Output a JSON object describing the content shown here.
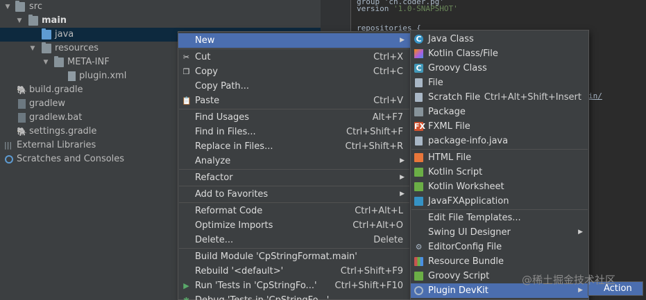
{
  "tree": {
    "items": [
      {
        "label": "src",
        "icon": "folder-icon",
        "arrow": "▼"
      },
      {
        "label": "main",
        "icon": "folder-icon",
        "arrow": "▼"
      },
      {
        "label": "java",
        "icon": "source-folder-icon",
        "arrow": ""
      },
      {
        "label": "resources",
        "icon": "resources-folder-icon",
        "arrow": "▼"
      },
      {
        "label": "META-INF",
        "icon": "folder-icon",
        "arrow": "▼"
      },
      {
        "label": "plugin.xml",
        "icon": "plugin-xml-icon",
        "arrow": ""
      },
      {
        "label": "build.gradle",
        "icon": "gradle-icon",
        "arrow": ""
      },
      {
        "label": "gradlew",
        "icon": "file-icon",
        "arrow": ""
      },
      {
        "label": "gradlew.bat",
        "icon": "file-icon",
        "arrow": ""
      },
      {
        "label": "settings.gradle",
        "icon": "gradle-icon",
        "arrow": ""
      },
      {
        "label": "External Libraries",
        "icon": "libraries-icon",
        "arrow": ""
      },
      {
        "label": "Scratches and Consoles",
        "icon": "scratches-icon",
        "arrow": ""
      }
    ]
  },
  "editor": {
    "line1": "group 'cn.coder.pg'",
    "line2_key": "version",
    "line2_val": "'1.0-SNAPSHOT'",
    "line3": "repositories {",
    "path_fragment": "in/"
  },
  "context_menu": {
    "items": [
      {
        "label": "New",
        "shortcut": "",
        "submenu": true
      },
      {
        "label": "Cut",
        "shortcut": "Ctrl+X",
        "icon": "cut-icon"
      },
      {
        "label": "Copy",
        "shortcut": "Ctrl+C",
        "icon": "copy-icon"
      },
      {
        "label": "Copy Path...",
        "shortcut": ""
      },
      {
        "label": "Paste",
        "shortcut": "Ctrl+V",
        "icon": "paste-icon"
      },
      {
        "label": "Find Usages",
        "shortcut": "Alt+F7"
      },
      {
        "label": "Find in Files...",
        "shortcut": "Ctrl+Shift+F"
      },
      {
        "label": "Replace in Files...",
        "shortcut": "Ctrl+Shift+R"
      },
      {
        "label": "Analyze",
        "shortcut": "",
        "submenu": true
      },
      {
        "label": "Refactor",
        "shortcut": "",
        "submenu": true
      },
      {
        "label": "Add to Favorites",
        "shortcut": "",
        "submenu": true
      },
      {
        "label": "Reformat Code",
        "shortcut": "Ctrl+Alt+L"
      },
      {
        "label": "Optimize Imports",
        "shortcut": "Ctrl+Alt+O"
      },
      {
        "label": "Delete...",
        "shortcut": "Delete"
      },
      {
        "label": "Build Module 'CpStringFormat.main'",
        "shortcut": ""
      },
      {
        "label": "Rebuild '<default>'",
        "shortcut": "Ctrl+Shift+F9"
      },
      {
        "label": "Run 'Tests in 'CpStringFo...'",
        "shortcut": "Ctrl+Shift+F10",
        "icon": "run-icon"
      },
      {
        "label": "Debug 'Tests in 'CpStringFo...'",
        "shortcut": "",
        "icon": "debug-icon"
      }
    ]
  },
  "new_submenu": {
    "items": [
      {
        "label": "Java Class",
        "shortcut": ""
      },
      {
        "label": "Kotlin Class/File",
        "shortcut": ""
      },
      {
        "label": "Groovy Class",
        "shortcut": ""
      },
      {
        "label": "File",
        "shortcut": ""
      },
      {
        "label": "Scratch File",
        "shortcut": "Ctrl+Alt+Shift+Insert"
      },
      {
        "label": "Package",
        "shortcut": ""
      },
      {
        "label": "FXML File",
        "shortcut": ""
      },
      {
        "label": "package-info.java",
        "shortcut": ""
      },
      {
        "label": "HTML File",
        "shortcut": ""
      },
      {
        "label": "Kotlin Script",
        "shortcut": ""
      },
      {
        "label": "Kotlin Worksheet",
        "shortcut": ""
      },
      {
        "label": "JavaFXApplication",
        "shortcut": ""
      },
      {
        "label": "Edit File Templates...",
        "shortcut": ""
      },
      {
        "label": "Swing UI Designer",
        "shortcut": "",
        "submenu": true
      },
      {
        "label": "EditorConfig File",
        "shortcut": ""
      },
      {
        "label": "Resource Bundle",
        "shortcut": ""
      },
      {
        "label": "Groovy Script",
        "shortcut": ""
      },
      {
        "label": "Plugin DevKit",
        "shortcut": "",
        "submenu": true
      }
    ]
  },
  "devkit_submenu": {
    "first_item": "Action"
  },
  "watermark": "@稀土掘金技术社区",
  "colors": {
    "highlight": "#4b6eaf",
    "background": "#3c3f41",
    "editor_bg": "#2b2b2b",
    "selection": "#0d293e"
  }
}
